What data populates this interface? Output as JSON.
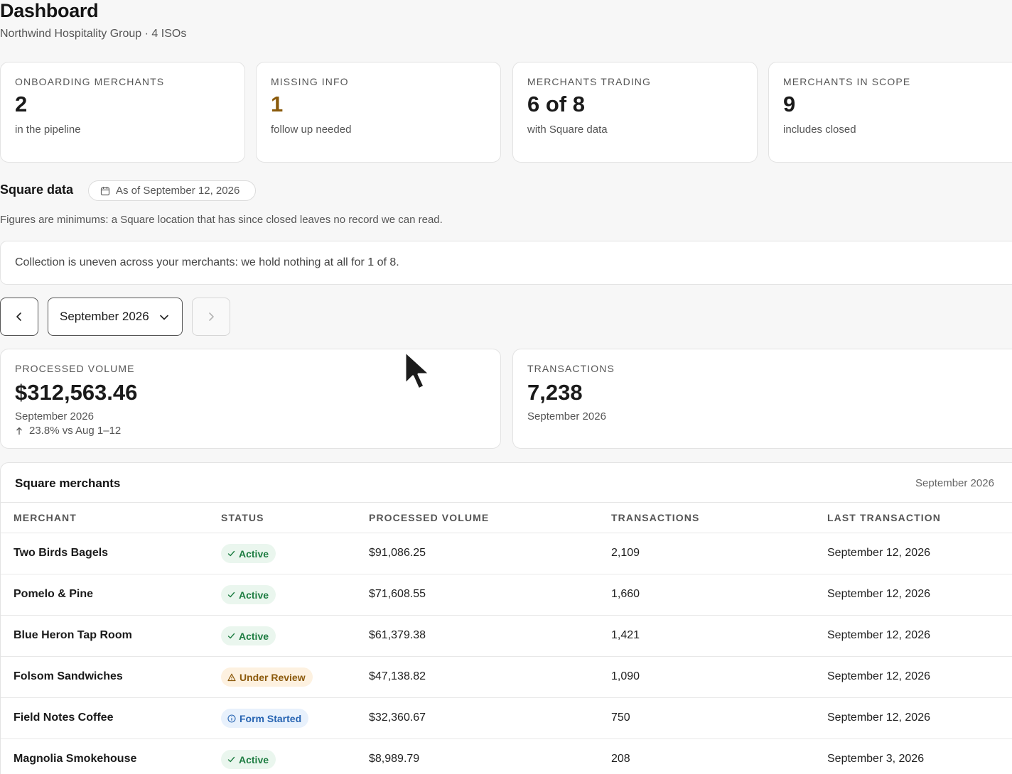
{
  "header": {
    "title": "Dashboard",
    "subtitle": "Northwind Hospitality Group · 4 ISOs"
  },
  "stats": [
    {
      "label": "ONBOARDING MERCHANTS",
      "value": "2",
      "note": "in the pipeline"
    },
    {
      "label": "MISSING INFO",
      "value": "1",
      "note": "follow up needed"
    },
    {
      "label": "MERCHANTS TRADING",
      "value": "6 of 8",
      "note": "with Square data"
    },
    {
      "label": "MERCHANTS IN SCOPE",
      "value": "9",
      "note": "includes closed"
    }
  ],
  "square": {
    "title": "Square data",
    "as_of": "As of September 12, 2026",
    "note": "Figures are minimums: a Square location that has since closed leaves no record we can read.",
    "notice": "Collection is uneven across your merchants: we hold nothing at all for 1 of 8."
  },
  "period": {
    "selected": "September 2026"
  },
  "metrics": {
    "volume": {
      "label": "PROCESSED VOLUME",
      "value": "$312,563.46",
      "note": "September 2026",
      "trend": "23.8% vs Aug 1–12"
    },
    "transactions": {
      "label": "TRANSACTIONS",
      "value": "7,238",
      "note": "September 2026"
    }
  },
  "table": {
    "title": "Square merchants",
    "period": "September 2026",
    "columns": [
      "MERCHANT",
      "STATUS",
      "PROCESSED VOLUME",
      "TRANSACTIONS",
      "LAST TRANSACTION"
    ],
    "rows": [
      {
        "merchant": "Two Birds Bagels",
        "status": "Active",
        "volume": "$91,086.25",
        "transactions": "2,109",
        "last": "September 12, 2026"
      },
      {
        "merchant": "Pomelo & Pine",
        "status": "Active",
        "volume": "$71,608.55",
        "transactions": "1,660",
        "last": "September 12, 2026"
      },
      {
        "merchant": "Blue Heron Tap Room",
        "status": "Active",
        "volume": "$61,379.38",
        "transactions": "1,421",
        "last": "September 12, 2026"
      },
      {
        "merchant": "Folsom Sandwiches",
        "status": "Under Review",
        "volume": "$47,138.82",
        "transactions": "1,090",
        "last": "September 12, 2026"
      },
      {
        "merchant": "Field Notes Coffee",
        "status": "Form Started",
        "volume": "$32,360.67",
        "transactions": "750",
        "last": "September 12, 2026"
      },
      {
        "merchant": "Magnolia Smokehouse",
        "status": "Active",
        "volume": "$8,989.79",
        "transactions": "208",
        "last": "September 3, 2026"
      }
    ]
  },
  "colors": {
    "accent_warn": "#8a5a0b",
    "status_active": "#1e7d42",
    "status_review": "#8c5a0c",
    "status_started": "#2764b2"
  },
  "icons": [
    "calendar-icon",
    "chevron-left-icon",
    "chevron-down-icon",
    "chevron-right-icon",
    "arrow-up-icon",
    "check-icon",
    "warning-icon",
    "info-icon",
    "mouse-cursor-icon"
  ]
}
